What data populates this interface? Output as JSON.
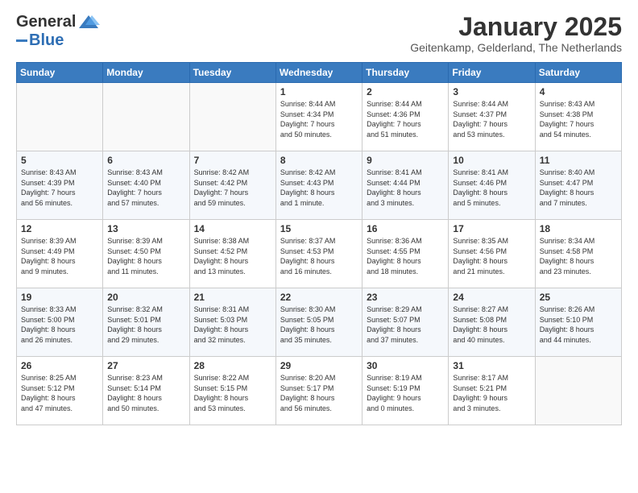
{
  "header": {
    "logo_general": "General",
    "logo_blue": "Blue",
    "month_title": "January 2025",
    "subtitle": "Geitenkamp, Gelderland, The Netherlands"
  },
  "weekdays": [
    "Sunday",
    "Monday",
    "Tuesday",
    "Wednesday",
    "Thursday",
    "Friday",
    "Saturday"
  ],
  "weeks": [
    [
      {
        "day": "",
        "info": ""
      },
      {
        "day": "",
        "info": ""
      },
      {
        "day": "",
        "info": ""
      },
      {
        "day": "1",
        "info": "Sunrise: 8:44 AM\nSunset: 4:34 PM\nDaylight: 7 hours\nand 50 minutes."
      },
      {
        "day": "2",
        "info": "Sunrise: 8:44 AM\nSunset: 4:36 PM\nDaylight: 7 hours\nand 51 minutes."
      },
      {
        "day": "3",
        "info": "Sunrise: 8:44 AM\nSunset: 4:37 PM\nDaylight: 7 hours\nand 53 minutes."
      },
      {
        "day": "4",
        "info": "Sunrise: 8:43 AM\nSunset: 4:38 PM\nDaylight: 7 hours\nand 54 minutes."
      }
    ],
    [
      {
        "day": "5",
        "info": "Sunrise: 8:43 AM\nSunset: 4:39 PM\nDaylight: 7 hours\nand 56 minutes."
      },
      {
        "day": "6",
        "info": "Sunrise: 8:43 AM\nSunset: 4:40 PM\nDaylight: 7 hours\nand 57 minutes."
      },
      {
        "day": "7",
        "info": "Sunrise: 8:42 AM\nSunset: 4:42 PM\nDaylight: 7 hours\nand 59 minutes."
      },
      {
        "day": "8",
        "info": "Sunrise: 8:42 AM\nSunset: 4:43 PM\nDaylight: 8 hours\nand 1 minute."
      },
      {
        "day": "9",
        "info": "Sunrise: 8:41 AM\nSunset: 4:44 PM\nDaylight: 8 hours\nand 3 minutes."
      },
      {
        "day": "10",
        "info": "Sunrise: 8:41 AM\nSunset: 4:46 PM\nDaylight: 8 hours\nand 5 minutes."
      },
      {
        "day": "11",
        "info": "Sunrise: 8:40 AM\nSunset: 4:47 PM\nDaylight: 8 hours\nand 7 minutes."
      }
    ],
    [
      {
        "day": "12",
        "info": "Sunrise: 8:39 AM\nSunset: 4:49 PM\nDaylight: 8 hours\nand 9 minutes."
      },
      {
        "day": "13",
        "info": "Sunrise: 8:39 AM\nSunset: 4:50 PM\nDaylight: 8 hours\nand 11 minutes."
      },
      {
        "day": "14",
        "info": "Sunrise: 8:38 AM\nSunset: 4:52 PM\nDaylight: 8 hours\nand 13 minutes."
      },
      {
        "day": "15",
        "info": "Sunrise: 8:37 AM\nSunset: 4:53 PM\nDaylight: 8 hours\nand 16 minutes."
      },
      {
        "day": "16",
        "info": "Sunrise: 8:36 AM\nSunset: 4:55 PM\nDaylight: 8 hours\nand 18 minutes."
      },
      {
        "day": "17",
        "info": "Sunrise: 8:35 AM\nSunset: 4:56 PM\nDaylight: 8 hours\nand 21 minutes."
      },
      {
        "day": "18",
        "info": "Sunrise: 8:34 AM\nSunset: 4:58 PM\nDaylight: 8 hours\nand 23 minutes."
      }
    ],
    [
      {
        "day": "19",
        "info": "Sunrise: 8:33 AM\nSunset: 5:00 PM\nDaylight: 8 hours\nand 26 minutes."
      },
      {
        "day": "20",
        "info": "Sunrise: 8:32 AM\nSunset: 5:01 PM\nDaylight: 8 hours\nand 29 minutes."
      },
      {
        "day": "21",
        "info": "Sunrise: 8:31 AM\nSunset: 5:03 PM\nDaylight: 8 hours\nand 32 minutes."
      },
      {
        "day": "22",
        "info": "Sunrise: 8:30 AM\nSunset: 5:05 PM\nDaylight: 8 hours\nand 35 minutes."
      },
      {
        "day": "23",
        "info": "Sunrise: 8:29 AM\nSunset: 5:07 PM\nDaylight: 8 hours\nand 37 minutes."
      },
      {
        "day": "24",
        "info": "Sunrise: 8:27 AM\nSunset: 5:08 PM\nDaylight: 8 hours\nand 40 minutes."
      },
      {
        "day": "25",
        "info": "Sunrise: 8:26 AM\nSunset: 5:10 PM\nDaylight: 8 hours\nand 44 minutes."
      }
    ],
    [
      {
        "day": "26",
        "info": "Sunrise: 8:25 AM\nSunset: 5:12 PM\nDaylight: 8 hours\nand 47 minutes."
      },
      {
        "day": "27",
        "info": "Sunrise: 8:23 AM\nSunset: 5:14 PM\nDaylight: 8 hours\nand 50 minutes."
      },
      {
        "day": "28",
        "info": "Sunrise: 8:22 AM\nSunset: 5:15 PM\nDaylight: 8 hours\nand 53 minutes."
      },
      {
        "day": "29",
        "info": "Sunrise: 8:20 AM\nSunset: 5:17 PM\nDaylight: 8 hours\nand 56 minutes."
      },
      {
        "day": "30",
        "info": "Sunrise: 8:19 AM\nSunset: 5:19 PM\nDaylight: 9 hours\nand 0 minutes."
      },
      {
        "day": "31",
        "info": "Sunrise: 8:17 AM\nSunset: 5:21 PM\nDaylight: 9 hours\nand 3 minutes."
      },
      {
        "day": "",
        "info": ""
      }
    ]
  ]
}
